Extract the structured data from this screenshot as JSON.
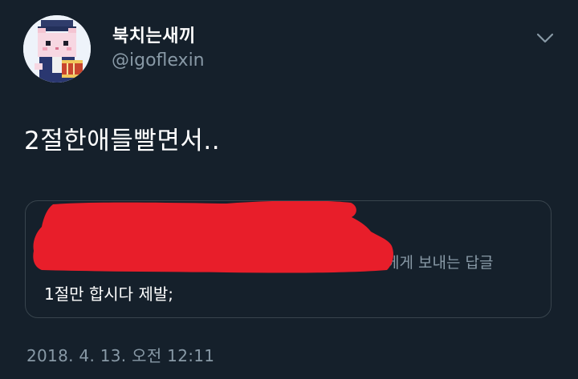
{
  "author": {
    "display_name": "북치는새끼",
    "handle": "@igoflexin",
    "avatar_icon": "pixel-cat-avatar-icon"
  },
  "menu": {
    "icon": "chevron-down-icon"
  },
  "tweet": {
    "text": "2절한애들빨면서..",
    "timestamp": "2018. 4. 13. 오전 12:11"
  },
  "quoted_tweet": {
    "reply_context": "에게 보내는 답글",
    "text": "1절만 합시다 제발;",
    "redaction_color": "#e81e2a"
  },
  "colors": {
    "background": "#15202b",
    "primary_text": "#ffffff",
    "secondary_text": "#8899a6",
    "border": "#38444d"
  }
}
